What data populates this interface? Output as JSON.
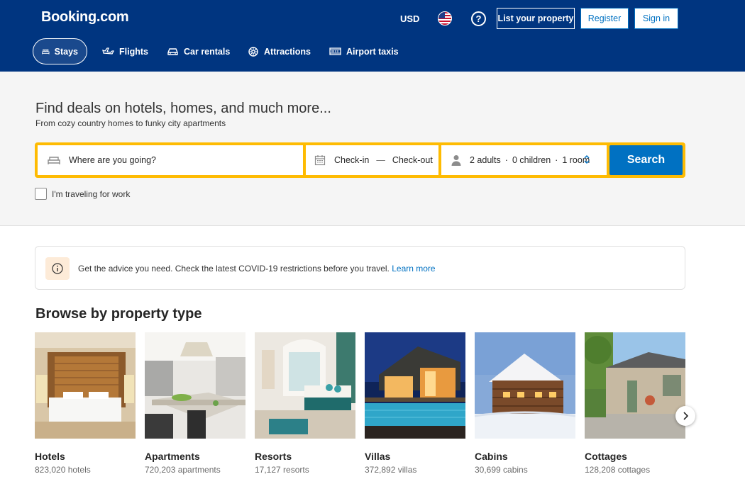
{
  "header": {
    "logo": "Booking.com",
    "currency": "USD",
    "help_label": "?",
    "list_property": "List your property",
    "register": "Register",
    "sign_in": "Sign in",
    "nav": [
      {
        "label": "Stays",
        "icon": "bed-icon",
        "active": true
      },
      {
        "label": "Flights",
        "icon": "plane-icon"
      },
      {
        "label": "Car rentals",
        "icon": "car-icon"
      },
      {
        "label": "Attractions",
        "icon": "attractions-icon"
      },
      {
        "label": "Airport taxis",
        "icon": "taxi-icon"
      }
    ]
  },
  "hero": {
    "title": "Find deals on hotels, homes, and much more...",
    "subtitle": "From cozy country homes to funky city apartments"
  },
  "search": {
    "destination_placeholder": "Where are you going?",
    "check_in": "Check-in",
    "dash": "—",
    "check_out": "Check-out",
    "adults": "2 adults",
    "children": "0 children",
    "rooms": "1 room",
    "sep": "·",
    "button": "Search",
    "work_label": "I'm traveling for work"
  },
  "banner": {
    "text": "Get the advice you need. Check the latest COVID-19 restrictions before you travel.",
    "link": "Learn more"
  },
  "browse": {
    "title": "Browse by property type",
    "items": [
      {
        "name": "Hotels",
        "count": "823,020 hotels"
      },
      {
        "name": "Apartments",
        "count": "720,203 apartments"
      },
      {
        "name": "Resorts",
        "count": "17,127 resorts"
      },
      {
        "name": "Villas",
        "count": "372,892 villas"
      },
      {
        "name": "Cabins",
        "count": "30,699 cabins"
      },
      {
        "name": "Cottages",
        "count": "128,208 cottages"
      }
    ]
  },
  "colors": {
    "brand_blue": "#003580",
    "accent_yellow": "#febb02",
    "button_blue": "#0071c2"
  }
}
